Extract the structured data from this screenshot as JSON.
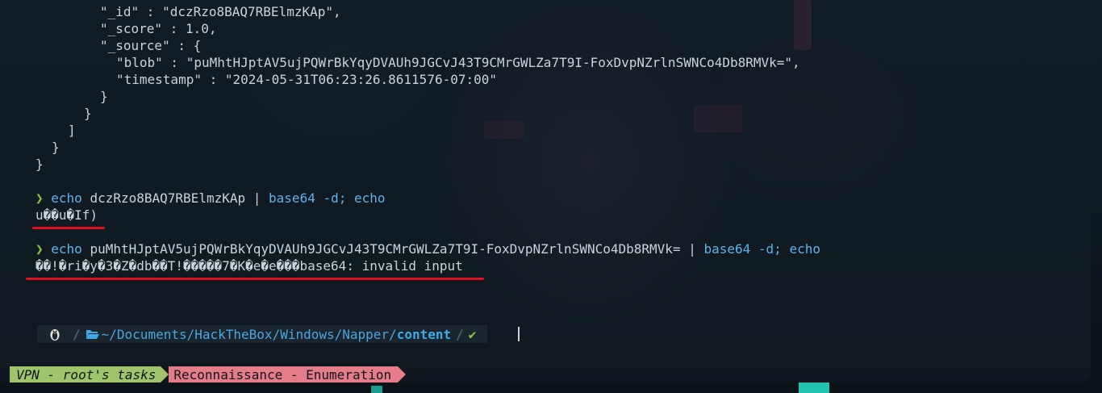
{
  "terminal": {
    "json_lines": [
      "\"_id\" : \"dczRzo8BAQ7RBElmzKAp\",",
      "\"_score\" : 1.0,",
      "\"_source\" : {",
      "\"blob\" : \"puMhtHJptAV5ujPQWrBkYqyDVAUh9JGCvJ43T9CMrGWLZa7T9I-FoxDvpNZrlnSWNCo4Db8RMVk=\",",
      "\"timestamp\" : \"2024-05-31T06:23:26.8611576-07:00\"",
      "}",
      "}",
      "]",
      "}",
      "}"
    ],
    "prompt_symbol": "❯",
    "command1": {
      "cmd": "echo",
      "arg": "dczRzo8BAQ7RBElmzKAp",
      "pipe": "|",
      "cmd2": "base64",
      "flag": "-d;",
      "cmd3": "echo",
      "output": "u��u�If)"
    },
    "command2": {
      "cmd": "echo",
      "arg": "puMhtHJptAV5ujPQWrBkYqyDVAUh9JGCvJ43T9CMrGWLZa7T9I-FoxDvpNZrlnSWNCo4Db8RMVk=",
      "pipe": "|",
      "cmd2": "base64",
      "flag": "-d;",
      "cmd3": "echo",
      "output": "��!�ri�y�3�Z�db��T!�����7�K�e�e���base64: invalid input"
    },
    "p10k_prompt": {
      "os_icon": "linux-tux-icon",
      "path_prefix": "~/Documents/HackTheBox/Windows/Napper/",
      "path_last": "content",
      "status": "✔"
    }
  },
  "statusbar": {
    "session": "VPN - root's tasks",
    "window": "Reconnaissance - Enumeration"
  },
  "colors": {
    "prompt_green": "#8cc63f",
    "command_blue": "#5fb3e8",
    "underline_red": "#e0101a",
    "session_tag": "#a0c46b",
    "window_tag": "#e57c8a"
  }
}
